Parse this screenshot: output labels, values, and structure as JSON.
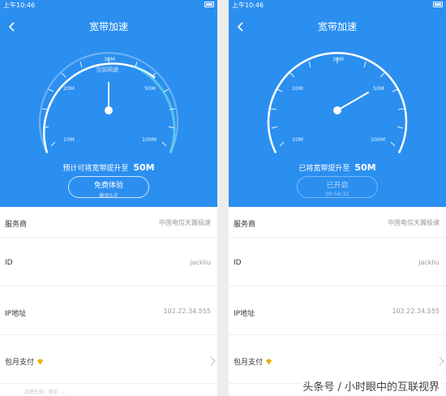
{
  "colors": {
    "accent": "#2b8ff0",
    "gold": "#e8b10c",
    "white": "#ffffff"
  },
  "gauge_labels": {
    "l10": "10M",
    "l20": "20M",
    "l30": "30M",
    "l50": "50M",
    "l100": "100M"
  },
  "left": {
    "status_time": "上午10:46",
    "title": "宽带加速",
    "gauge_sub": "当前网速",
    "needle_speed_mbps": 30,
    "hint_text": "预计可将宽带提升至",
    "hint_value": "50M",
    "button_main": "免费体验",
    "button_sub": "剩余5次"
  },
  "right": {
    "status_time": "上午10:46",
    "title": "宽带加速",
    "needle_speed_mbps": 50,
    "hint_text": "已将宽带提升至",
    "hint_value": "50M",
    "button_main": "已开启",
    "button_sub": "00:58:32"
  },
  "rows": {
    "provider_label": "服务商",
    "provider_value": "中国电信天翼极速",
    "id_label": "ID",
    "id_value": "jackliu",
    "ip_label": "IP地址",
    "ip_value": "102.22.34.555",
    "monthly_label": "包月支付"
  },
  "footnote": "加速生效 · 剩余 ...",
  "watermark": "头条号 / 小时眼中的互联视界"
}
